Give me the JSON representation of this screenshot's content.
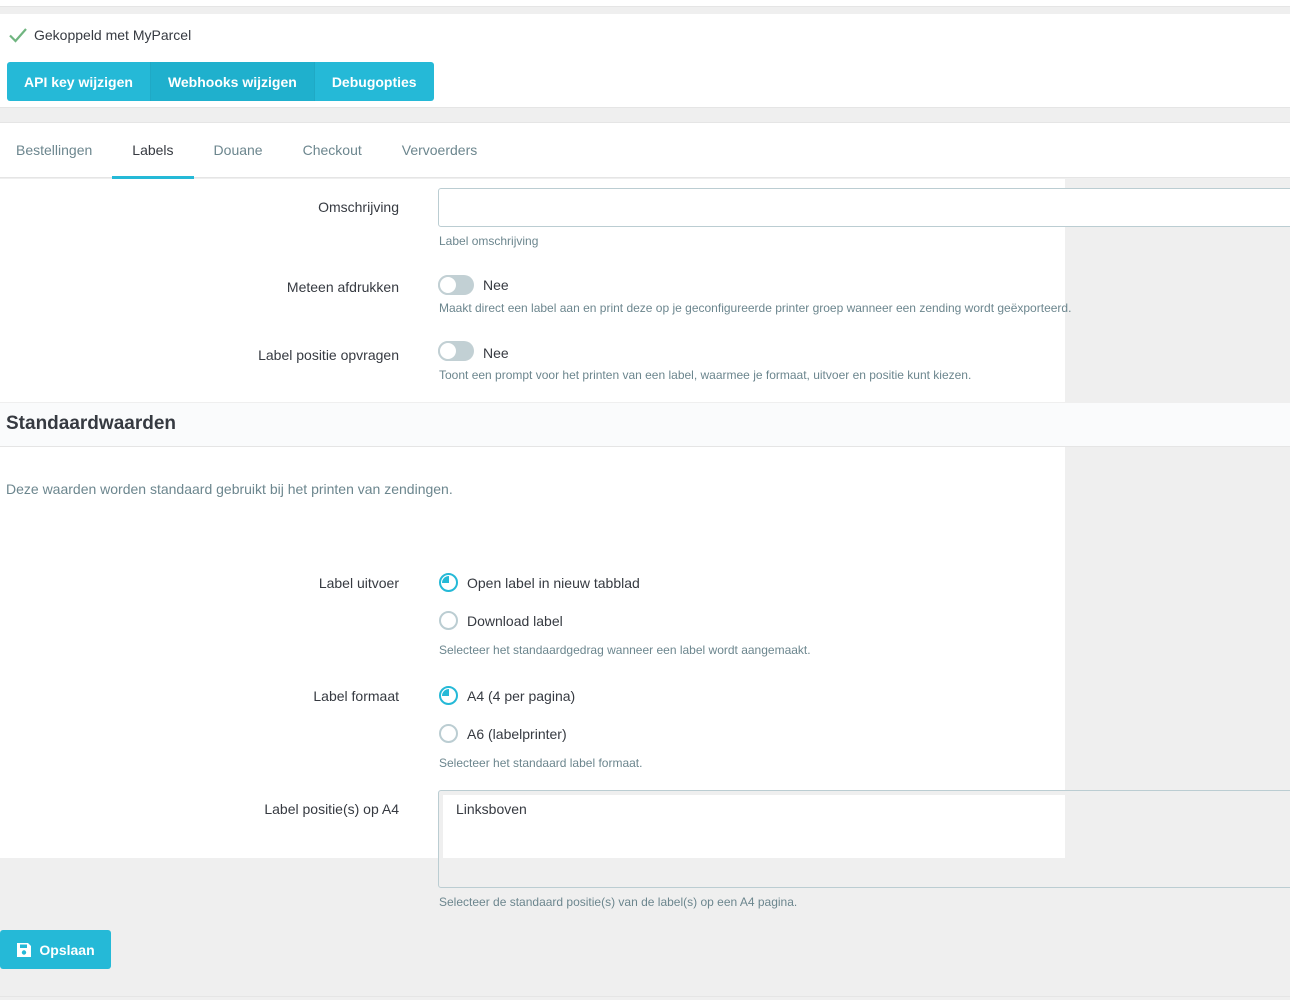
{
  "connection": {
    "status_text": "Gekoppeld met MyParcel",
    "buttons": [
      {
        "label": "API key wijzigen"
      },
      {
        "label": "Webhooks wijzigen"
      },
      {
        "label": "Debugopties"
      }
    ]
  },
  "tabs": [
    {
      "label": "Bestellingen"
    },
    {
      "label": "Labels"
    },
    {
      "label": "Douane"
    },
    {
      "label": "Checkout"
    },
    {
      "label": "Vervoerders"
    }
  ],
  "active_tab": "Labels",
  "form": {
    "description": {
      "label": "Omschrijving",
      "value": "",
      "help": "Label omschrijving"
    },
    "print_immediately": {
      "label": "Meteen afdrukken",
      "state": "Nee",
      "help": "Maakt direct een label aan en print deze op je geconfigureerde printer groep wanneer een zending wordt geëxporteerd."
    },
    "ask_position": {
      "label": "Label positie opvragen",
      "state": "Nee",
      "help": "Toont een prompt voor het printen van een label, waarmee je formaat, uitvoer en positie kunt kiezen."
    }
  },
  "defaults": {
    "title": "Standaardwaarden",
    "description": "Deze waarden worden standaard gebruikt bij het printen van zendingen.",
    "output": {
      "label": "Label uitvoer",
      "options": [
        {
          "label": "Open label in nieuw tabblad",
          "checked": true
        },
        {
          "label": "Download label",
          "checked": false
        }
      ],
      "help": "Selecteer het standaardgedrag wanneer een label wordt aangemaakt."
    },
    "format": {
      "label": "Label formaat",
      "options": [
        {
          "label": "A4 (4 per pagina)",
          "checked": true
        },
        {
          "label": "A6 (labelprinter)",
          "checked": false
        }
      ],
      "help": "Selecteer het standaard label formaat."
    },
    "positions": {
      "label": "Label positie(s) op A4",
      "selected": "Linksboven",
      "help": "Selecteer de standaard positie(s) van de label(s) op een A4 pagina."
    }
  },
  "save_label": "Opslaan",
  "colors": {
    "primary": "#25b9d7",
    "success": "#70b580",
    "text": "#363a41",
    "muted": "#6c868e"
  }
}
